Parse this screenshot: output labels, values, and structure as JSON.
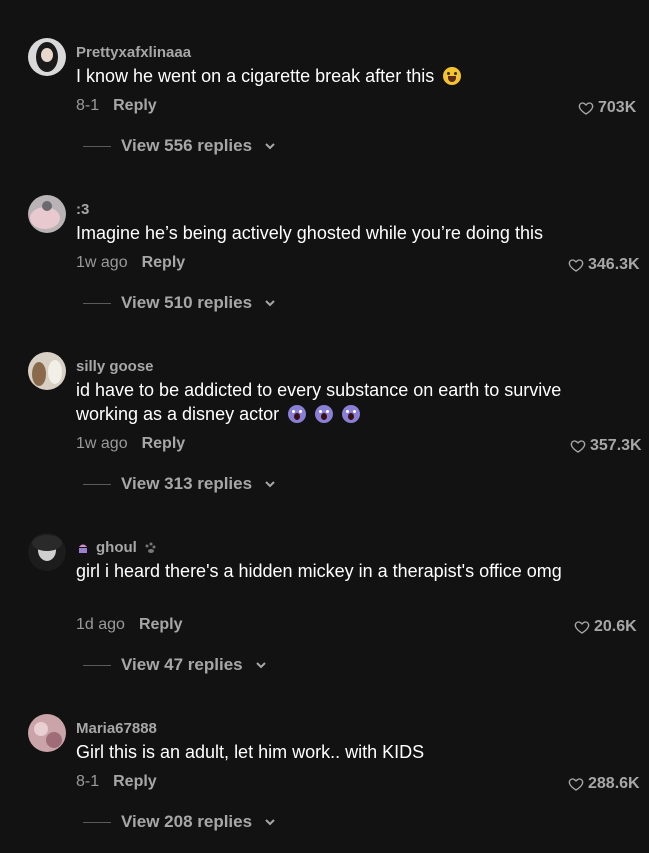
{
  "comments": [
    {
      "username": "Prettyxafxlinaaa",
      "text": "I know he went on a cigarette break after this",
      "emoji": "grinning-sweat-emoji",
      "date": "8-1",
      "reply": "Reply",
      "likes": "703K",
      "view_replies": "View 556 replies"
    },
    {
      "username": ":3",
      "text": "Imagine he’s being actively ghosted while you’re doing this",
      "date": "1w ago",
      "reply": "Reply",
      "likes": "346.3K",
      "view_replies": "View 510 replies"
    },
    {
      "username": "silly goose",
      "text": "id have to be addicted to every substance on earth to survive working as a disney actor",
      "emoji": "screaming-face-emoji",
      "date": "1w ago",
      "reply": "Reply",
      "likes": "357.3K",
      "view_replies": "View 313 replies"
    },
    {
      "username": "ghoul",
      "text": "girl i heard there's a hidden mickey in a therapist's office omg",
      "date": "1d ago",
      "reply": "Reply",
      "likes": "20.6K",
      "view_replies": "View 47 replies"
    },
    {
      "username": "Maria67888",
      "text": "Girl this is an adult, let him work.. with KIDS",
      "date": "8-1",
      "reply": "Reply",
      "likes": "288.6K",
      "view_replies": "View 208 replies"
    }
  ],
  "colors": {
    "background": "#121212",
    "text": "#ffffff",
    "muted": "#a7a7a7"
  }
}
